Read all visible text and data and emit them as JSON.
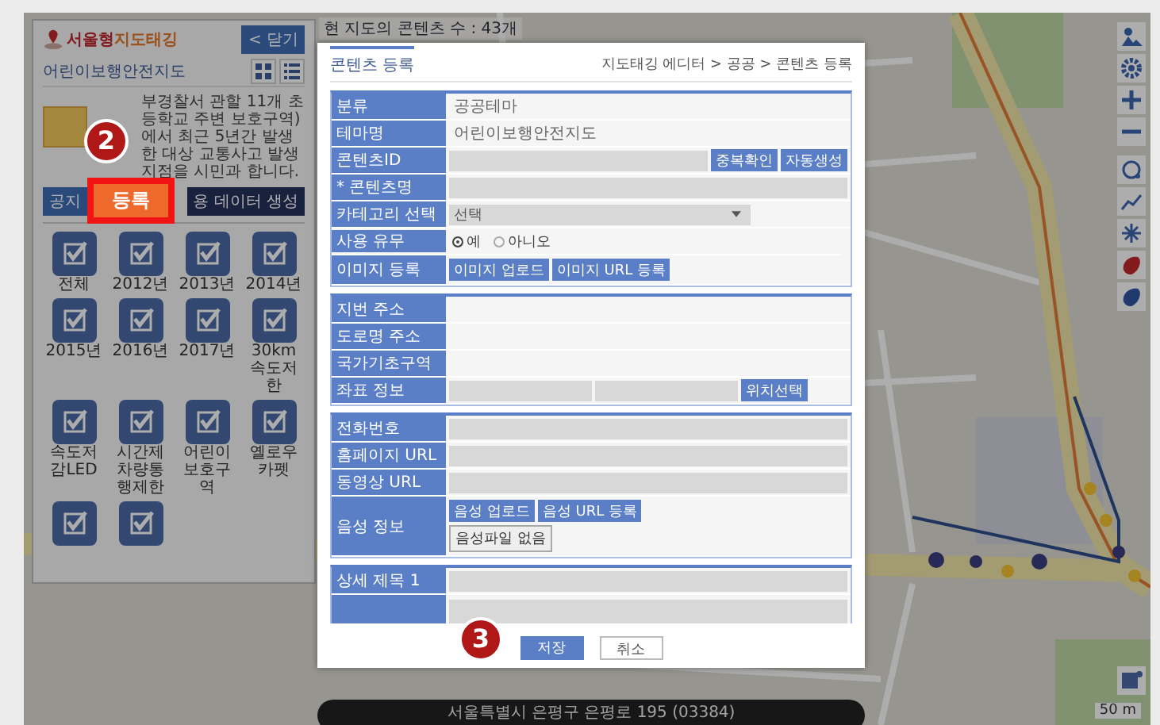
{
  "map_overlay": {
    "content_count": "현 지도의 콘텐츠 수 : 43개",
    "address": "서울특별시 은평구 은평로 195 (03384)",
    "scale": "50 m"
  },
  "side_panel": {
    "logo": {
      "part1": "서울형",
      "part2": "지도태깅"
    },
    "close_button": "< 닫기",
    "theme_title": "어린이보행안전지도",
    "description": "부경찰서 관할 11개 초등학교 주변 보호구역)에서 최근 5년간 발생한 대상 교통사고 발생 지점을 시민과 합니다.",
    "buttons": [
      "공지",
      "용 데이터 생성"
    ],
    "register_button": {
      "label": "등록",
      "callout": "2"
    },
    "layers": [
      {
        "label": "전체",
        "checked": true
      },
      {
        "label": "2012년",
        "checked": true
      },
      {
        "label": "2013년",
        "checked": true
      },
      {
        "label": "2014년",
        "checked": true
      },
      {
        "label": "2015년",
        "checked": true
      },
      {
        "label": "2016년",
        "checked": true
      },
      {
        "label": "2017년",
        "checked": true
      },
      {
        "label": "30km속도저한",
        "checked": true
      },
      {
        "label": "속도저감LED",
        "checked": true
      },
      {
        "label": "시간제차량통행제한",
        "checked": true
      },
      {
        "label": "어린이보호구역",
        "checked": true
      },
      {
        "label": "옐로우카펫",
        "checked": true
      },
      {
        "checked": true
      },
      {
        "checked": true
      }
    ]
  },
  "modal": {
    "title": "콘텐츠 등록",
    "breadcrumb": "지도태깅 에디터 > 공공 > 콘텐츠 등록",
    "sections": [
      {
        "rows": [
          {
            "kind": "text",
            "label": "분류",
            "value": "공공테마"
          },
          {
            "kind": "text",
            "label": "테마명",
            "value": "어린이보행안전지도"
          },
          {
            "kind": "input",
            "label": "콘텐츠ID",
            "buttons": [
              "중복확인",
              "자동생성"
            ]
          },
          {
            "kind": "input",
            "label": "* 콘텐츠명"
          },
          {
            "kind": "select",
            "label": "카테고리 선택",
            "value": "선택"
          },
          {
            "kind": "radio",
            "label": "사용 유무",
            "options": [
              {
                "label": "예",
                "selected": true
              },
              {
                "label": "아니오",
                "selected": false
              }
            ]
          },
          {
            "kind": "buttons",
            "label": "이미지 등록",
            "buttons": [
              "이미지 업로드",
              "이미지 URL 등록"
            ]
          }
        ]
      },
      {
        "rows": [
          {
            "kind": "readonly",
            "label": "지번 주소"
          },
          {
            "kind": "readonly",
            "label": "도로명 주소"
          },
          {
            "kind": "readonly",
            "label": "국가기초구역"
          },
          {
            "kind": "coordinates",
            "label": "좌표 정보",
            "buttons": [
              "위치선택"
            ]
          }
        ]
      },
      {
        "rows": [
          {
            "kind": "input",
            "label": "전화번호"
          },
          {
            "kind": "input",
            "label": "홈페이지 URL"
          },
          {
            "kind": "input",
            "label": "동영상 URL"
          },
          {
            "kind": "buttons",
            "label": "음성 정보",
            "buttons": [
              "음성 업로드",
              "음성 URL 등록"
            ],
            "file_button": "음성파일 없음"
          }
        ]
      },
      {
        "rows": [
          {
            "kind": "input",
            "label": "상세 제목 1"
          },
          {
            "kind": "textarea"
          }
        ]
      }
    ],
    "footer": {
      "callout": "3",
      "buttons": [
        {
          "label": "저장",
          "kind": "primary"
        },
        {
          "label": "취소",
          "kind": "secondary"
        }
      ]
    }
  }
}
